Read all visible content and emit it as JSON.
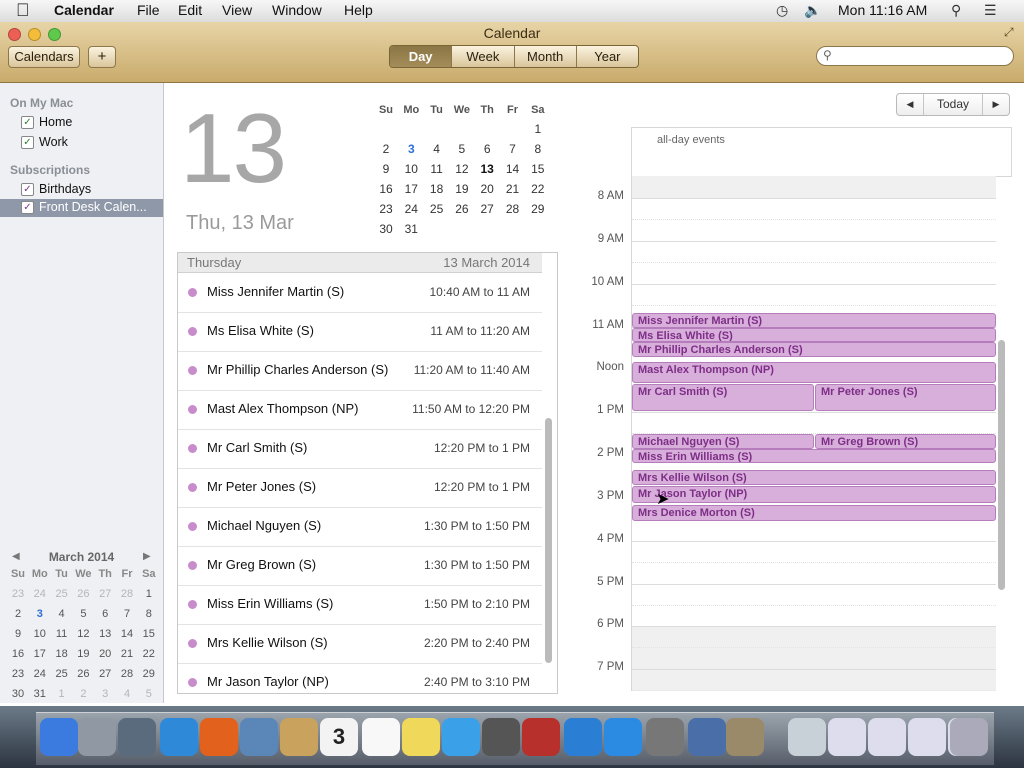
{
  "menubar": {
    "app_name": "Calendar",
    "menus": [
      "File",
      "Edit",
      "View",
      "Window",
      "Help"
    ],
    "clock": "Mon 11:16 AM"
  },
  "window": {
    "title": "Calendar",
    "calendars_button": "Calendars",
    "add_button": "+",
    "views": [
      "Day",
      "Week",
      "Month",
      "Year"
    ],
    "active_view": "Day",
    "search_placeholder": ""
  },
  "sidebar": {
    "section_mac": "On My Mac",
    "mac_items": [
      {
        "label": "Home",
        "checked": true
      },
      {
        "label": "Work",
        "checked": true
      }
    ],
    "section_subs": "Subscriptions",
    "sub_items": [
      {
        "label": "Birthdays",
        "checked": true
      },
      {
        "label": "Front Desk Calen...",
        "checked": true
      }
    ],
    "mini_calendar": {
      "title": "March 2014",
      "prev": "◀",
      "next": "▶",
      "weekdays": [
        "Su",
        "Mo",
        "Tu",
        "We",
        "Th",
        "Fr",
        "Sa"
      ],
      "weeks": [
        [
          "23",
          "24",
          "25",
          "26",
          "27",
          "28",
          "1"
        ],
        [
          "2",
          "3",
          "4",
          "5",
          "6",
          "7",
          "8"
        ],
        [
          "9",
          "10",
          "11",
          "12",
          "13",
          "14",
          "15"
        ],
        [
          "16",
          "17",
          "18",
          "19",
          "20",
          "21",
          "22"
        ],
        [
          "23",
          "24",
          "25",
          "26",
          "27",
          "28",
          "29"
        ],
        [
          "30",
          "31",
          "1",
          "2",
          "3",
          "4",
          "5"
        ]
      ],
      "today": "3"
    }
  },
  "dayview": {
    "big_day": "13",
    "date_label": "Thu, 13 Mar",
    "month_weekdays": [
      "Su",
      "Mo",
      "Tu",
      "We",
      "Th",
      "Fr",
      "Sa"
    ],
    "month_weeks": [
      [
        "",
        "",
        "",
        "",
        "",
        "",
        "1"
      ],
      [
        "2",
        "3",
        "4",
        "5",
        "6",
        "7",
        "8"
      ],
      [
        "9",
        "10",
        "11",
        "12",
        "13",
        "14",
        "15"
      ],
      [
        "16",
        "17",
        "18",
        "19",
        "20",
        "21",
        "22"
      ],
      [
        "23",
        "24",
        "25",
        "26",
        "27",
        "28",
        "29"
      ],
      [
        "30",
        "31",
        "",
        "",
        "",
        "",
        ""
      ]
    ],
    "list_header_day": "Thursday",
    "list_header_date": "13 March 2014",
    "events": [
      {
        "name": "Miss Jennifer Martin (S)",
        "time": "10:40 AM to 11 AM"
      },
      {
        "name": "Ms Elisa White (S)",
        "time": "11 AM to 11:20 AM"
      },
      {
        "name": "Mr Phillip Charles Anderson (S)",
        "time": "11:20 AM to 11:40 AM"
      },
      {
        "name": "Mast Alex Thompson (NP)",
        "time": "11:50 AM to 12:20 PM"
      },
      {
        "name": "Mr Carl Smith (S)",
        "time": "12:20 PM to 1 PM"
      },
      {
        "name": "Mr Peter Jones (S)",
        "time": "12:20 PM to 1 PM"
      },
      {
        "name": "Michael Nguyen (S)",
        "time": "1:30 PM to 1:50 PM"
      },
      {
        "name": "Mr Greg Brown (S)",
        "time": "1:30 PM to 1:50 PM"
      },
      {
        "name": "Miss Erin Williams (S)",
        "time": "1:50 PM to 2:10 PM"
      },
      {
        "name": "Mrs Kellie Wilson (S)",
        "time": "2:20 PM to 2:40 PM"
      },
      {
        "name": "Mr Jason Taylor (NP)",
        "time": "2:40 PM to 3:10 PM"
      }
    ],
    "nav": {
      "prev": "◀",
      "today": "Today",
      "next": "▶"
    },
    "all_day_label": "all-day events",
    "hours": [
      "8 AM",
      "9 AM",
      "10 AM",
      "11 AM",
      "Noon",
      "1 PM",
      "2 PM",
      "3 PM",
      "4 PM",
      "5 PM",
      "6 PM",
      "7 PM"
    ],
    "grid_events": [
      {
        "name": "Miss Jennifer Martin (S)"
      },
      {
        "name": "Ms Elisa White (S)"
      },
      {
        "name": "Mr Phillip Charles Anderson (S)"
      },
      {
        "name": "Mast Alex Thompson (NP)"
      },
      {
        "name": "Mr Carl Smith (S)"
      },
      {
        "name": "Mr Peter Jones (S)"
      },
      {
        "name": "Michael Nguyen (S)"
      },
      {
        "name": "Mr Greg Brown (S)"
      },
      {
        "name": "Miss Erin Williams (S)"
      },
      {
        "name": "Mrs Kellie Wilson (S)"
      },
      {
        "name": "Mr Jason Taylor (NP)"
      },
      {
        "name": "Mrs Denice Morton (S)"
      }
    ]
  },
  "colors": {
    "event_fill": "#d8aedb",
    "event_text": "#7d2f86",
    "toolbar": "#c9ab6c"
  },
  "dock": {
    "icons": [
      "finder-icon",
      "launchpad-icon",
      "photo-icon",
      "safari-icon",
      "firefox-icon",
      "mail-icon",
      "contacts-icon",
      "calendar-icon",
      "reminders-icon",
      "notes-icon",
      "messages-icon",
      "facetime-icon",
      "photo-booth-icon",
      "itunes-icon",
      "app-store-icon",
      "system-preferences-icon",
      "xcode-icon",
      "keychain-icon",
      "preview-icon",
      "window-icon",
      "window-icon",
      "window-icon",
      "window-icon",
      "trash-icon"
    ],
    "calendar_day": "3"
  }
}
